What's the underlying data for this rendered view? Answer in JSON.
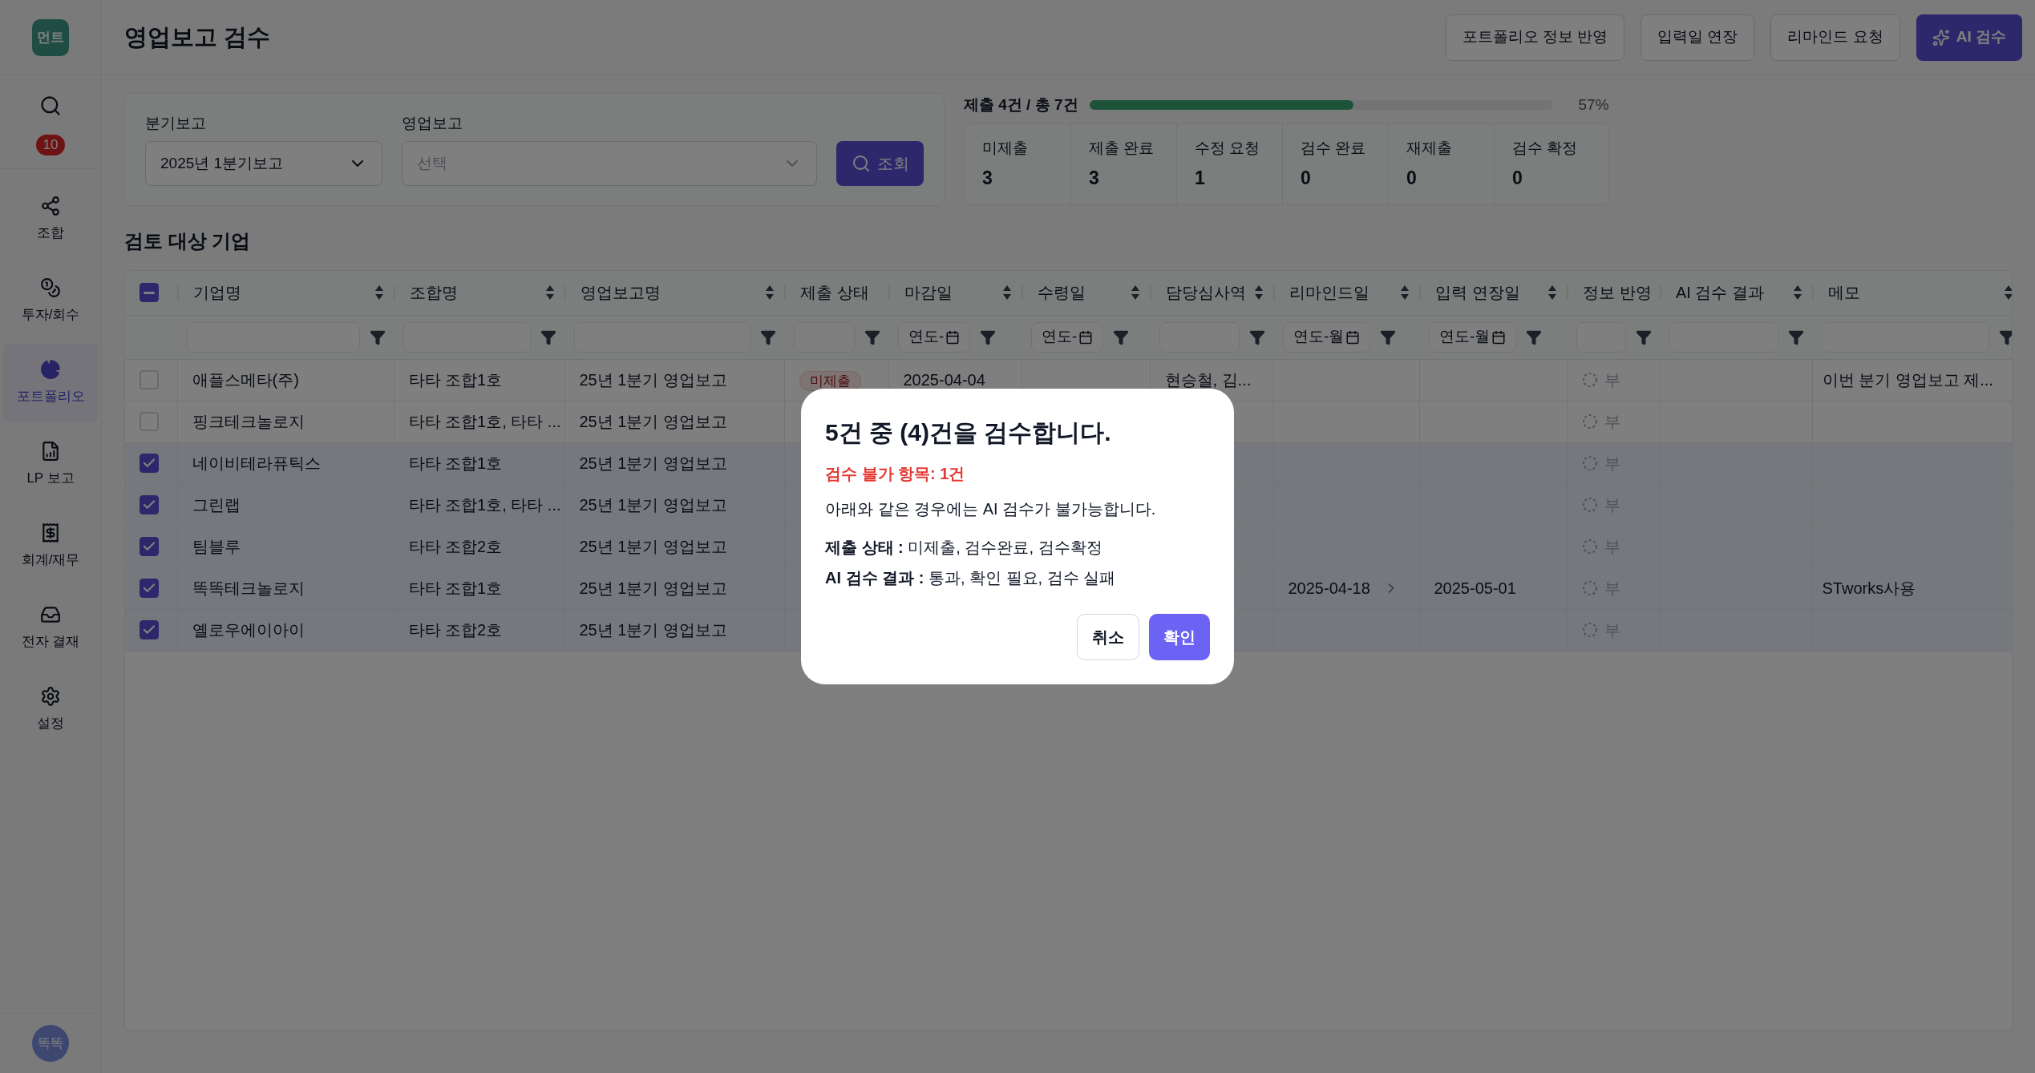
{
  "sidebar": {
    "logo": "먼트",
    "badge": "10",
    "items": [
      {
        "label": "조합",
        "selected": false
      },
      {
        "label": "투자/회수",
        "selected": false
      },
      {
        "label": "포트폴리오",
        "selected": true
      },
      {
        "label": "LP 보고",
        "selected": false
      },
      {
        "label": "회계/재무",
        "selected": false
      },
      {
        "label": "전자 결재",
        "selected": false
      },
      {
        "label": "설정",
        "selected": false
      }
    ],
    "avatar": "똑똑"
  },
  "header": {
    "title": "영업보고 검수",
    "actions": [
      {
        "label": "포트폴리오 정보 반영",
        "kind": "outline"
      },
      {
        "label": "입력일 연장",
        "kind": "outline"
      },
      {
        "label": "리마인드 요청",
        "kind": "outline"
      },
      {
        "label": "AI 검수",
        "kind": "primary"
      }
    ]
  },
  "filters": {
    "fields": [
      {
        "label": "분기보고",
        "value": "2025년 1분기보고"
      },
      {
        "label": "영업보고",
        "placeholder": "선택"
      }
    ],
    "search_button": "조회"
  },
  "progress": {
    "label": "제출 4건 / 총 7건",
    "level": 0.57,
    "percent": "57%"
  },
  "stats": [
    {
      "label": "미제출",
      "value": "3"
    },
    {
      "label": "제출 완료",
      "value": "3"
    },
    {
      "label": "수정 요청",
      "value": "1"
    },
    {
      "label": "검수 완료",
      "value": "0"
    },
    {
      "label": "재제출",
      "value": "0"
    },
    {
      "label": "검수 확정",
      "value": "0"
    }
  ],
  "section_title": "검토 대상 기업",
  "table": {
    "partially_checked": true,
    "columns": [
      {
        "label": "기업명",
        "sortable": true,
        "kind": "text"
      },
      {
        "label": "조합명",
        "sortable": true,
        "kind": "text"
      },
      {
        "label": "영업보고명",
        "sortable": true,
        "kind": "text"
      },
      {
        "label": "제출 상태",
        "sortable": false,
        "kind": "text"
      },
      {
        "label": "마감일",
        "sortable": true,
        "kind": "date",
        "filter_text": "연도-"
      },
      {
        "label": "수령일",
        "sortable": true,
        "kind": "date",
        "filter_text": "연도-"
      },
      {
        "label": "담당심사역",
        "sortable": true,
        "kind": "text"
      },
      {
        "label": "리마인드일",
        "sortable": true,
        "kind": "date",
        "filter_text": "연도-월"
      },
      {
        "label": "입력 연장일",
        "sortable": true,
        "kind": "date",
        "filter_text": "연도-월"
      },
      {
        "label": "정보 반영",
        "sortable": false,
        "kind": "text"
      },
      {
        "label": "AI 검수 결과",
        "sortable": true,
        "kind": "text"
      },
      {
        "label": "메모",
        "sortable": true,
        "kind": "text"
      }
    ],
    "rows": [
      {
        "checked": false,
        "company": "애플스메타(주)",
        "fund": "타타 조합1호",
        "report": "25년 1분기 영업보고",
        "status": "미제출",
        "deadline": "2025-04-04",
        "assignee": "현승철, 김...",
        "info": "부",
        "memo": "이번 분기 영업보고 제..."
      },
      {
        "checked": false,
        "company": "핑크테크놀로지",
        "fund": "타타 조합1호, 타타 ...",
        "report": "25년 1분기 영업보고",
        "info": "부"
      },
      {
        "checked": true,
        "company": "네이비테라퓨틱스",
        "fund": "타타 조합1호",
        "report": "25년 1분기 영업보고",
        "info": "부"
      },
      {
        "checked": true,
        "company": "그린랩",
        "fund": "타타 조합1호, 타타 ...",
        "report": "25년 1분기 영업보고",
        "info": "부"
      },
      {
        "checked": true,
        "company": "팀블루",
        "fund": "타타 조합2호",
        "report": "25년 1분기 영업보고",
        "info": "부"
      },
      {
        "checked": true,
        "company": "똑똑테크놀로지",
        "fund": "타타 조합1호",
        "report": "25년 1분기 영업보고",
        "remind": "2025-04-18",
        "extend": "2025-05-01",
        "info": "부",
        "memo": "STworks사용"
      },
      {
        "checked": true,
        "company": "옐로우에이아이",
        "fund": "타타 조합2호",
        "report": "25년 1분기 영업보고",
        "info": "부"
      }
    ]
  },
  "dialog": {
    "title": "5건 중 (4)건을 검수합니다.",
    "warning": "검수 불가 항목: 1건",
    "description": "아래와 같은 경우에는 AI 검수가 불가능합니다.",
    "rules": [
      "**제출 상태 :** 미제출, 검수완료, 검수확정",
      "**AI 검수 결과 :** 통과, 확인 필요, 검수 실패"
    ],
    "buttons": [
      {
        "label": "취소",
        "kind": "secondary"
      },
      {
        "label": "확인",
        "kind": "primary"
      }
    ]
  }
}
